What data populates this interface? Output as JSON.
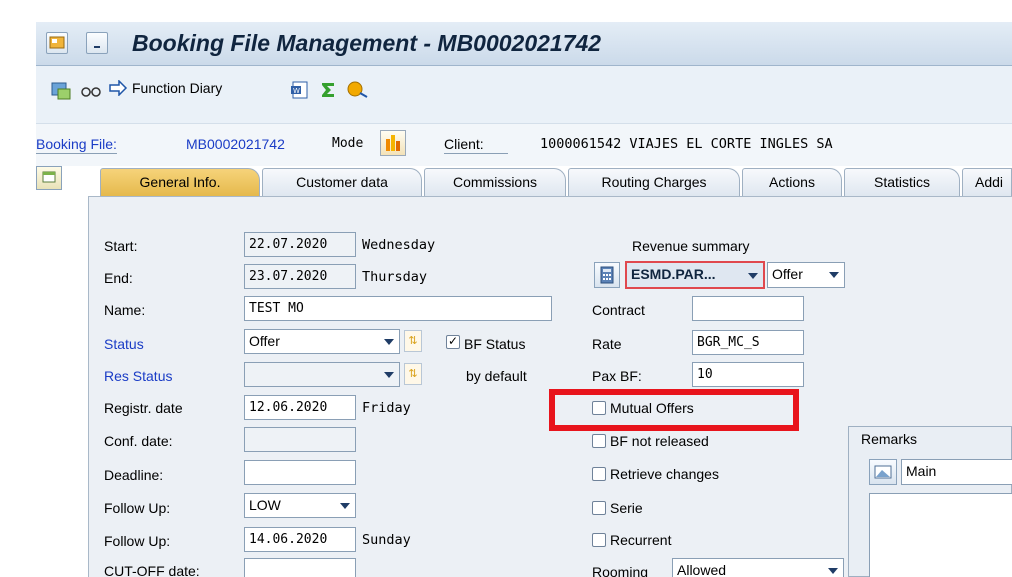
{
  "window": {
    "title": "Booking File Management - MB0002021742"
  },
  "toolbar": {
    "function_diary": "Function Diary"
  },
  "header": {
    "booking_file_label": "Booking File:",
    "booking_file_value": "MB0002021742",
    "mode_label": "Mode",
    "client_label": "Client:",
    "client_value": "1000061542 VIAJES EL CORTE INGLES SA"
  },
  "tabs": [
    {
      "label": "General Info."
    },
    {
      "label": "Customer data"
    },
    {
      "label": "Commissions"
    },
    {
      "label": "Routing Charges"
    },
    {
      "label": "Actions"
    },
    {
      "label": "Statistics"
    },
    {
      "label": "Addi"
    }
  ],
  "form": {
    "start_label": "Start:",
    "start_value": "22.07.2020",
    "start_day": "Wednesday",
    "end_label": "End:",
    "end_value": "23.07.2020",
    "end_day": "Thursday",
    "name_label": "Name:",
    "name_value": "TEST MO",
    "status_label": "Status",
    "status_value": "Offer",
    "bf_status_label": "BF Status",
    "res_status_label": "Res Status",
    "res_status_value": "",
    "by_default_label": "by default",
    "registr_label": "Registr. date",
    "registr_value": "12.06.2020",
    "registr_day": "Friday",
    "conf_label": "Conf. date:",
    "conf_value": "",
    "deadline_label": "Deadline:",
    "deadline_value": "",
    "follow_up_label": "Follow Up:",
    "follow_up_value": "LOW",
    "follow_up2_label": "Follow Up:",
    "follow_up2_value": "14.06.2020",
    "follow_up2_day": "Sunday",
    "cutoff_label": "CUT-OFF date:",
    "cutoff_value": ""
  },
  "right": {
    "revenue_summary_label": "Revenue summary",
    "revenue_select_value": "ESMD.PAR...",
    "revenue_type_value": "Offer",
    "contract_label": "Contract",
    "contract_value": "",
    "rate_label": "Rate",
    "rate_value": "BGR_MC_S",
    "pax_label": "Pax BF:",
    "pax_value": "10",
    "mutual_offers_label": "Mutual Offers",
    "bf_not_released_label": "BF not released",
    "retrieve_changes_label": "Retrieve changes",
    "serie_label": "Serie",
    "recurrent_label": "Recurrent",
    "rooming_label": "Rooming",
    "rooming_value": "Allowed"
  },
  "remarks": {
    "title": "Remarks",
    "select_value": "Main"
  },
  "colors": {
    "highlight_box": "#e8141c",
    "link_blue": "#1a3cc6"
  }
}
